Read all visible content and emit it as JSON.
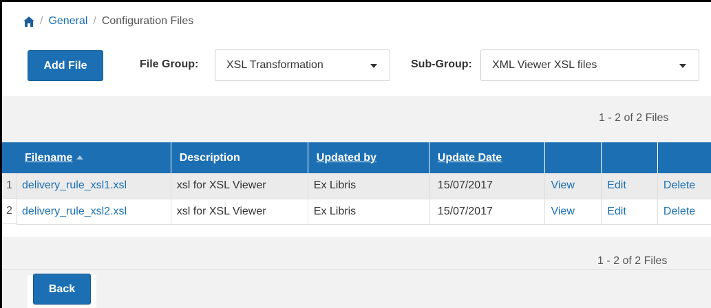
{
  "breadcrumb": {
    "items": [
      "General",
      "Configuration Files"
    ]
  },
  "toolbar": {
    "add_label": "Add File",
    "file_group_label": "File Group:",
    "file_group_value": "XSL Transformation",
    "sub_group_label": "Sub-Group:",
    "sub_group_value": "XML Viewer XSL files"
  },
  "pagination": {
    "top": "1 - 2 of 2 Files",
    "bottom": "1 - 2 of 2 Files"
  },
  "table": {
    "headers": {
      "filename": "Filename",
      "description": "Description",
      "updated_by": "Updated by",
      "update_date": "Update Date"
    },
    "rows": [
      {
        "num": "1",
        "filename": "delivery_rule_xsl1.xsl",
        "description": "xsl for XSL Viewer",
        "updated_by": "Ex Libris",
        "update_date": "15/07/2017",
        "view": "View",
        "edit": "Edit",
        "delete": "Delete"
      },
      {
        "num": "2",
        "filename": "delivery_rule_xsl2.xsl",
        "description": "xsl for XSL Viewer",
        "updated_by": "Ex Libris",
        "update_date": "15/07/2017",
        "view": "View",
        "edit": "Edit",
        "delete": "Delete"
      }
    ]
  },
  "footer": {
    "back_label": "Back"
  },
  "colors": {
    "accent": "#1c6fb3",
    "link": "#1a6fb2",
    "band": "#f2f2f2"
  },
  "icons": {
    "home": "home-icon",
    "sort": "sort-ascending-icon",
    "dropdown": "chevron-down-icon"
  }
}
